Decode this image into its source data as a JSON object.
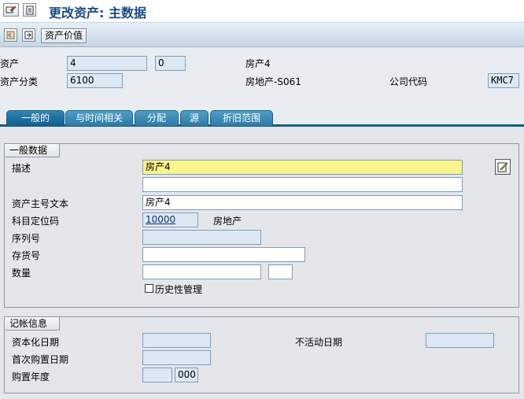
{
  "window": {
    "title": "更改资产: 主数据"
  },
  "toolbar": {
    "asset_value_button": "资产价值"
  },
  "header": {
    "asset_label": "资产",
    "asset_number": "4",
    "asset_subnumber": "0",
    "asset_description": "房产4",
    "asset_class_label": "资产分类",
    "asset_class": "6100",
    "asset_class_description": "房地产-S061",
    "company_code_label": "公司代码",
    "company_code": "KMC7"
  },
  "tabs": [
    {
      "label": "一般的",
      "active": true
    },
    {
      "label": "与时间相关",
      "active": false
    },
    {
      "label": "分配",
      "active": false
    },
    {
      "label": "源",
      "active": false
    },
    {
      "label": "折旧范围",
      "active": false
    }
  ],
  "general": {
    "group_title": "一般数据",
    "description_label": "描述",
    "description_value": "房产4",
    "description2_value": "",
    "main_text_label": "资产主号文本",
    "main_text_value": "房产4",
    "account_det_label": "科目定位码",
    "account_det_value": "10000",
    "account_det_text": "房地产",
    "serial_label": "序列号",
    "serial_value": "",
    "inventory_label": "存货号",
    "inventory_value": "",
    "quantity_label": "数量",
    "quantity_value": "",
    "quantity_unit": "",
    "history_label": "历史性管理",
    "history_checked": false
  },
  "posting": {
    "group_title": "记帐信息",
    "cap_date_label": "资本化日期",
    "cap_date_value": "",
    "deactivation_label": "不活动日期",
    "deactivation_value": "",
    "first_acq_label": "首次购置日期",
    "first_acq_value": "",
    "acq_year_label": "购置年度",
    "acq_year_value": "",
    "acq_period_value": "000"
  },
  "colors": {
    "tab_active": "#0f5e8f",
    "readonly_field": "#dde8f5",
    "required_field": "#fbf68c",
    "title": "#1a4a86"
  }
}
